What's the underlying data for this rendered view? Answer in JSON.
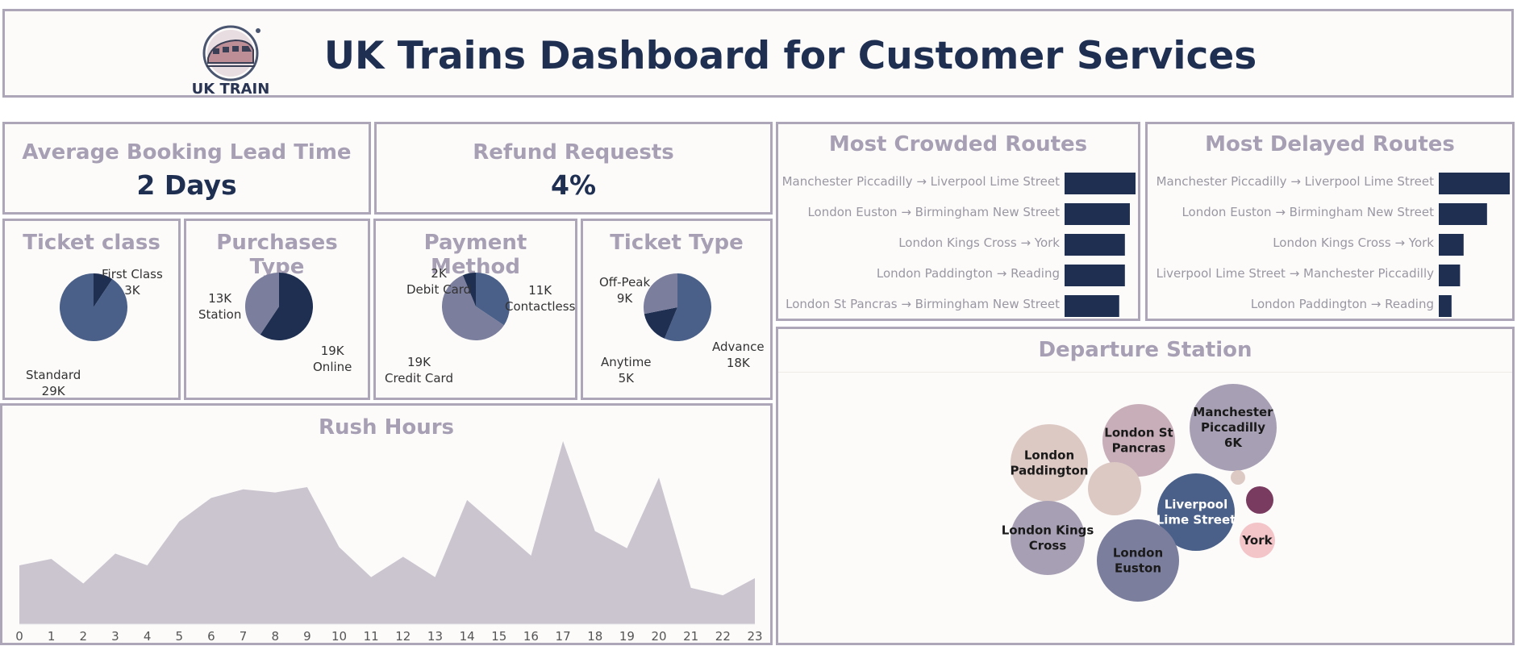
{
  "header": {
    "title": "UK Trains Dashboard for Customer Services",
    "logo_text": "UK TRAIN"
  },
  "kpis": {
    "lead_time": {
      "title": "Average Booking Lead Time",
      "value": "2 Days"
    },
    "refunds": {
      "title": "Refund Requests",
      "value": "4%"
    }
  },
  "colors": {
    "navy": "#1e2f52",
    "slate": "#4a6089",
    "gray_purple": "#7b7e9c",
    "muted": "#a79fb3",
    "area": "#cbc5d0",
    "border": "#ada5b8"
  },
  "chart_data": [
    {
      "id": "ticket_class",
      "type": "pie",
      "title": "Ticket class",
      "slices": [
        {
          "label": "First Class",
          "value_label": "3K",
          "value": 3,
          "color": "#1e2f52"
        },
        {
          "label": "Standard",
          "value_label": "29K",
          "value": 29,
          "color": "#4a6089"
        }
      ]
    },
    {
      "id": "purchases_type",
      "type": "pie",
      "title": "Purchases Type",
      "slices": [
        {
          "label": "Online",
          "value_label": "19K",
          "value": 19,
          "color": "#1e2f52"
        },
        {
          "label": "Station",
          "value_label": "13K",
          "value": 13,
          "color": "#7b7e9c"
        }
      ]
    },
    {
      "id": "payment_method",
      "type": "pie",
      "title": "Payment Method",
      "slices": [
        {
          "label": "Contactless",
          "value_label": "11K",
          "value": 11,
          "color": "#4a6089"
        },
        {
          "label": "Credit Card",
          "value_label": "19K",
          "value": 19,
          "color": "#7b7e9c"
        },
        {
          "label": "Debit Card",
          "value_label": "2K",
          "value": 2,
          "color": "#1e2f52"
        }
      ]
    },
    {
      "id": "ticket_type",
      "type": "pie",
      "title": "Ticket Type",
      "slices": [
        {
          "label": "Advance",
          "value_label": "18K",
          "value": 18,
          "color": "#4a6089"
        },
        {
          "label": "Anytime",
          "value_label": "5K",
          "value": 5,
          "color": "#1e2f52"
        },
        {
          "label": "Off-Peak",
          "value_label": "9K",
          "value": 9,
          "color": "#7b7e9c"
        }
      ]
    },
    {
      "id": "crowded",
      "type": "bar",
      "title": "Most Crowded Routes",
      "categories": [
        "Manchester Piccadilly → Liverpool Lime Street",
        "London Euston → Birmingham New Street",
        "London Kings Cross → York",
        "London Paddington → Reading",
        "London St Pancras → Birmingham New Street"
      ],
      "values": [
        100,
        92,
        85,
        85,
        77
      ]
    },
    {
      "id": "delayed",
      "type": "bar",
      "title": "Most Delayed Routes",
      "categories": [
        "Manchester Piccadilly → Liverpool Lime Street",
        "London Euston → Birmingham New Street",
        "London Kings Cross → York",
        "Liverpool Lime Street → Manchester Piccadilly",
        "London Paddington → Reading"
      ],
      "values": [
        100,
        68,
        35,
        30,
        18
      ]
    },
    {
      "id": "rush_hours",
      "type": "area",
      "title": "Rush Hours",
      "x": [
        0,
        1,
        2,
        3,
        4,
        5,
        6,
        7,
        8,
        9,
        10,
        11,
        12,
        13,
        14,
        15,
        16,
        17,
        18,
        19,
        20,
        21,
        22,
        23
      ],
      "values": [
        55,
        61,
        38,
        66,
        55,
        96,
        118,
        126,
        123,
        128,
        72,
        44,
        63,
        44,
        116,
        90,
        64,
        171,
        87,
        71,
        137,
        34,
        27,
        43
      ],
      "ylim": [
        0,
        180
      ]
    },
    {
      "id": "departure_station",
      "type": "bubble",
      "title": "Departure Station",
      "bubbles": [
        {
          "label": "Manchester Piccadilly 6K",
          "lines": [
            "Manchester",
            "Piccadilly",
            "6K"
          ],
          "value": 6,
          "color": "#a79fb3",
          "text": "#1a1a1a"
        },
        {
          "label": "London St Pancras",
          "lines": [
            "London St",
            "Pancras"
          ],
          "value": 4.2,
          "color": "#c8aeb9",
          "text": "#1a1a1a"
        },
        {
          "label": "London Paddington",
          "lines": [
            "London",
            "Paddington"
          ],
          "value": 4.9,
          "color": "#dcc9c3",
          "text": "#1a1a1a"
        },
        {
          "label": "",
          "lines": [],
          "value": 2.2,
          "color": "#dcc9c3",
          "text": "#1a1a1a"
        },
        {
          "label": "Liverpool Lime Street",
          "lines": [
            "Liverpool",
            "Lime Street"
          ],
          "value": 4.9,
          "color": "#4a6089",
          "text": "#ffffff"
        },
        {
          "label": "London Kings Cross",
          "lines": [
            "London Kings",
            "Cross"
          ],
          "value": 4.4,
          "color": "#a79fb3",
          "text": "#1a1a1a"
        },
        {
          "label": "London Euston",
          "lines": [
            "London",
            "Euston"
          ],
          "value": 5.2,
          "color": "#7b7e9c",
          "text": "#1a1a1a"
        },
        {
          "label": "",
          "lines": [],
          "value": 0.6,
          "color": "#7a3b60",
          "text": "#ffffff"
        },
        {
          "label": "York",
          "lines": [
            "York"
          ],
          "value": 1.0,
          "color": "#f3c4c8",
          "text": "#1a1a1a"
        },
        {
          "label": "",
          "lines": [],
          "value": 0.15,
          "color": "#dcc9c3",
          "text": "#1a1a1a"
        }
      ]
    }
  ]
}
